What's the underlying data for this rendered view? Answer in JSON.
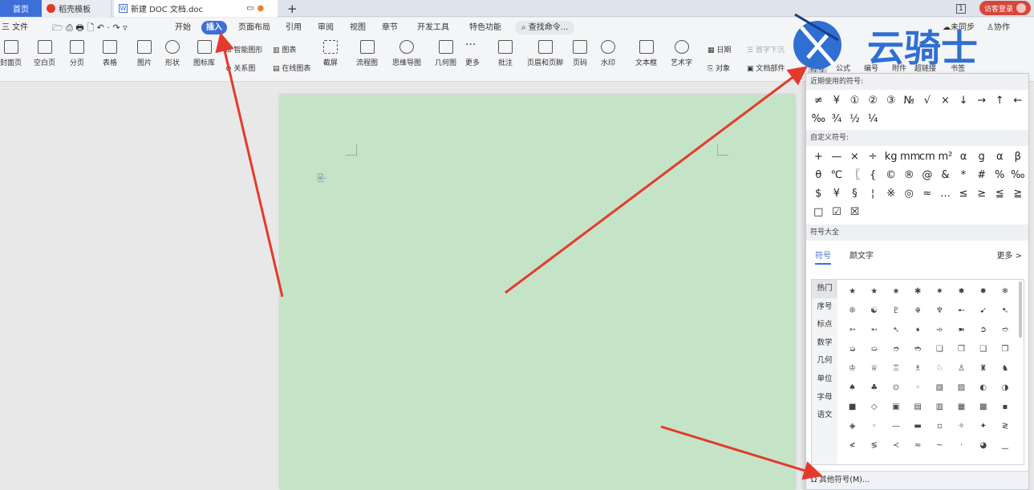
{
  "titlebar": {
    "home": "首页",
    "dao": "稻壳模板",
    "doc": "新建 DOC 文档.doc",
    "plus": "+",
    "visitor": "访客登录",
    "num": "1"
  },
  "menu": {
    "file": "三 文件",
    "start": "开始",
    "insert": "插入",
    "layout": "页面布局",
    "ref": "引用",
    "review": "审阅",
    "view": "视图",
    "chapter": "章节",
    "dev": "开发工具",
    "special": "特色功能",
    "search": "查找命令...",
    "sync": "未同步",
    "collab": "协作"
  },
  "ribbon": {
    "cover": "封面页",
    "blank": "空白页",
    "pagebreak": "分页",
    "table": "表格",
    "picture": "图片",
    "shape": "形状",
    "iconlib": "图标库",
    "smartart": "智能图形",
    "relation": "关系图",
    "chart": "图表",
    "onlinechart": "在线图表",
    "screenshot": "截屏",
    "flow": "流程图",
    "mindmap": "思维导图",
    "geometry": "几何图",
    "more": "更多",
    "comment": "批注",
    "headerfooter": "页眉和页脚",
    "pagenum": "页码",
    "watermark": "水印",
    "textbox": "文本框",
    "wordart": "艺术字",
    "date": "日期",
    "object": "对象",
    "dropcap": "首字下沉",
    "docpart": "文档部件",
    "symbol": "符号",
    "formula": "公式",
    "number": "编号",
    "attach": "附件",
    "hyperlink": "超链接",
    "bookmark": "书签"
  },
  "logo": {
    "text": "云骑士"
  },
  "panel": {
    "recent_title": "近期使用的符号:",
    "recent": [
      "≠",
      "¥",
      "①",
      "②",
      "③",
      "№",
      "√",
      "×",
      "↓",
      "→",
      "↑",
      "←",
      "‰",
      "¾",
      "½",
      "¼"
    ],
    "custom_title": "自定义符号:",
    "custom": [
      "+",
      "—",
      "×",
      "÷",
      "kg",
      "mm",
      "cm",
      "m²",
      "α",
      "g",
      "α",
      "β",
      "θ",
      "℃",
      "〖",
      "{",
      "©",
      "®",
      "@",
      "&",
      "*",
      "#",
      "%",
      "‰",
      "$",
      "¥",
      "§",
      "¦",
      "※",
      "◎",
      "≈",
      "…",
      "≤",
      "≥",
      "≦",
      "≧",
      "□",
      "☑",
      "☒"
    ],
    "library_title": "符号大全",
    "tab_symbol": "符号",
    "tab_emoji": "颜文字",
    "more": "更多 >",
    "categories": [
      "热门",
      "序号",
      "标点",
      "数学",
      "几何",
      "单位",
      "字母",
      "语文"
    ],
    "grid": [
      "★",
      "★",
      "★",
      "✱",
      "✷",
      "✸",
      "✹",
      "❄",
      "❊",
      "☯",
      "♇",
      "☬",
      "♆",
      "➸",
      "➹",
      "➷",
      "➳",
      "➵",
      "➴",
      "➧",
      "➾",
      "➽",
      "➲",
      "➱",
      "➭",
      "➯",
      "➮",
      "➬",
      "❏",
      "❐",
      "❑",
      "❒",
      "♔",
      "♕",
      "♖",
      "♗",
      "♘",
      "♙",
      "♜",
      "♞",
      "♠",
      "♣",
      "⊙",
      "◦",
      "▧",
      "▨",
      "◐",
      "◑",
      "■",
      "◇",
      "▣",
      "▤",
      "▥",
      "▦",
      "▩",
      "▪",
      "◈",
      "◦",
      "—",
      "▬",
      "▫",
      "✧",
      "✦",
      "≷",
      "≮",
      "≶",
      "≺",
      "≈",
      "~",
      "·",
      "◕",
      "‿"
    ],
    "more_symbols": "其他符号(M)..."
  }
}
